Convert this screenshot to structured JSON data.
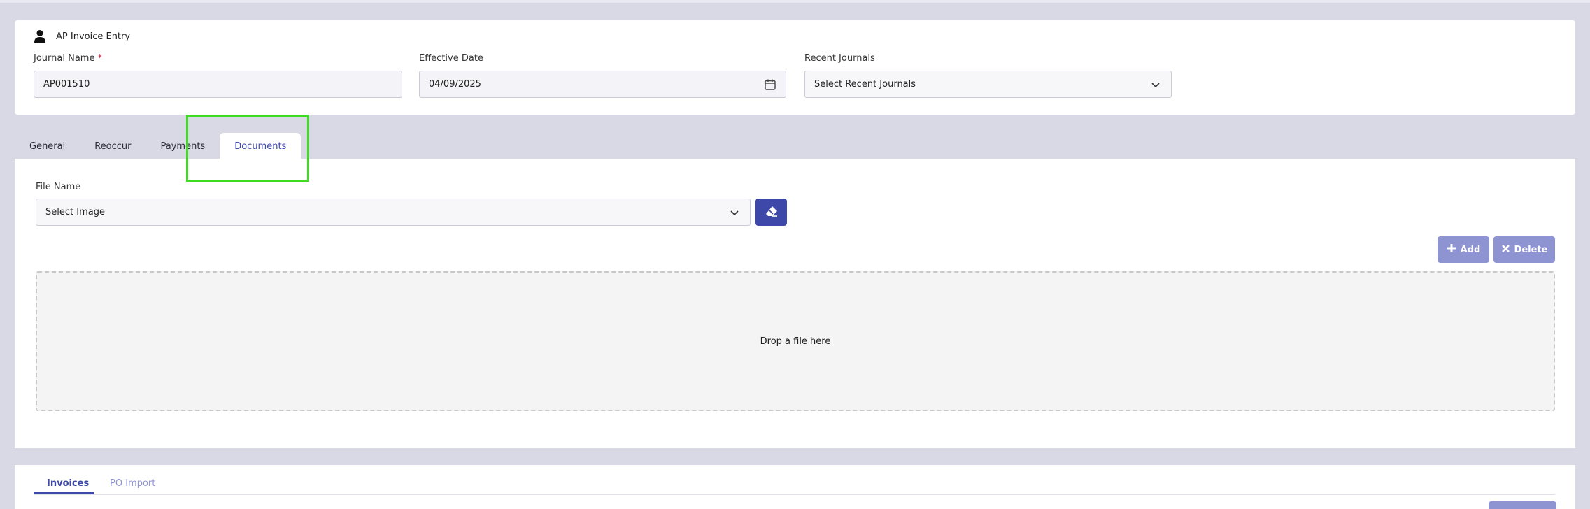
{
  "header": {
    "title": "AP Invoice Entry",
    "journal_name_label": "Journal Name",
    "required_marker": "*",
    "journal_name_value": "AP001510",
    "effective_date_label": "Effective Date",
    "effective_date_value": "04/09/2025",
    "recent_journals_label": "Recent Journals",
    "recent_journals_value": "Select Recent Journals"
  },
  "tabs": [
    {
      "label": "General",
      "active": false
    },
    {
      "label": "Reoccur",
      "active": false
    },
    {
      "label": "Payments",
      "active": false
    },
    {
      "label": "Documents",
      "active": true
    }
  ],
  "documents": {
    "file_name_label": "File Name",
    "file_select_value": "Select Image",
    "add_label": "Add",
    "delete_label": "Delete",
    "drop_text": "Drop a file here"
  },
  "bottom_tabs": [
    {
      "label": "Invoices",
      "active": true
    },
    {
      "label": "PO Import",
      "active": false
    }
  ],
  "colors": {
    "accent": "#3d48a8",
    "accent_light": "#8e94d1",
    "highlight": "#3ddc1f",
    "background": "#d9d9e5",
    "required": "#d3213b"
  },
  "icons": {
    "header": "person-icon",
    "date": "calendar-icon",
    "dropdown": "chevron-down-icon",
    "clear": "eraser-icon",
    "add": "plus-icon",
    "delete": "close-icon"
  }
}
